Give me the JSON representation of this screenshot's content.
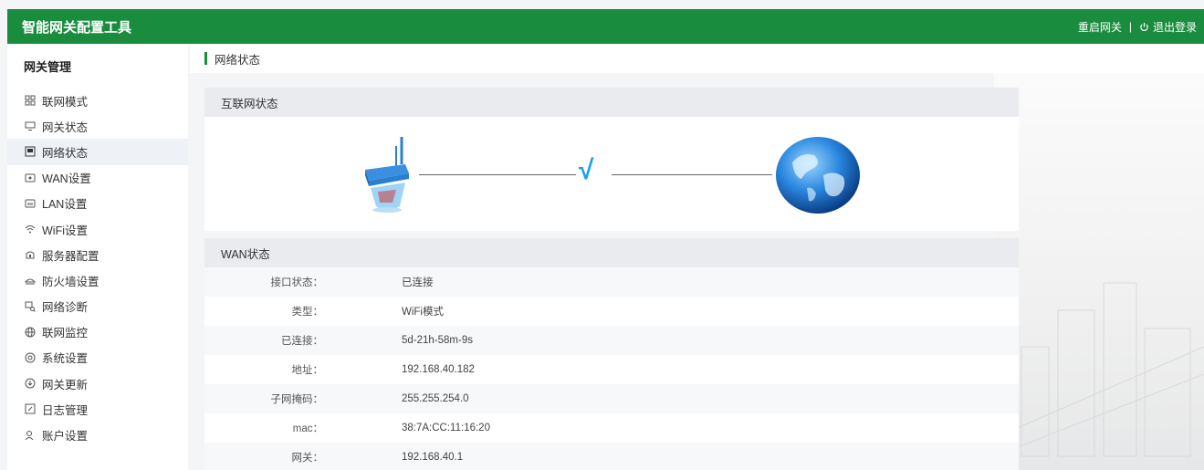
{
  "app": {
    "title": "智能网关配置工具"
  },
  "topbar": {
    "restart_label": "重启网关",
    "separator": "|",
    "logout_label": "退出登录"
  },
  "sidebar": {
    "header": "网关管理",
    "items": [
      {
        "label": "联网模式",
        "icon": "grid-icon"
      },
      {
        "label": "网关状态",
        "icon": "monitor-icon"
      },
      {
        "label": "网络状态",
        "icon": "picture-icon",
        "active": true
      },
      {
        "label": "WAN设置",
        "icon": "wan-icon"
      },
      {
        "label": "LAN设置",
        "icon": "lan-icon"
      },
      {
        "label": "WiFi设置",
        "icon": "wifi-icon"
      },
      {
        "label": "服务器配置",
        "icon": "server-icon"
      },
      {
        "label": "防火墙设置",
        "icon": "firewall-icon"
      },
      {
        "label": "网络诊断",
        "icon": "diagnose-icon"
      },
      {
        "label": "联网监控",
        "icon": "monitor-globe-icon"
      },
      {
        "label": "系统设置",
        "icon": "settings-icon"
      },
      {
        "label": "网关更新",
        "icon": "update-icon"
      },
      {
        "label": "日志管理",
        "icon": "log-icon"
      },
      {
        "label": "账户设置",
        "icon": "user-icon"
      }
    ]
  },
  "main": {
    "breadcrumb": "网络状态",
    "internet_panel": {
      "title": "互联网状态",
      "status_mark": "√"
    },
    "wan_panel": {
      "title": "WAN状态",
      "rows": [
        {
          "key": "接口状态：",
          "value": "已连接"
        },
        {
          "key": "类型：",
          "value": "WiFi模式"
        },
        {
          "key": "已连接：",
          "value": "5d-21h-58m-9s"
        },
        {
          "key": "地址：",
          "value": "192.168.40.182"
        },
        {
          "key": "子网掩码：",
          "value": "255.255.254.0"
        },
        {
          "key": "mac：",
          "value": "38:7A:CC:11:16:20"
        },
        {
          "key": "网关：",
          "value": "192.168.40.1"
        }
      ]
    }
  },
  "colors": {
    "brand_green": "#1a8c3e",
    "check_blue": "#1aa0e6"
  }
}
